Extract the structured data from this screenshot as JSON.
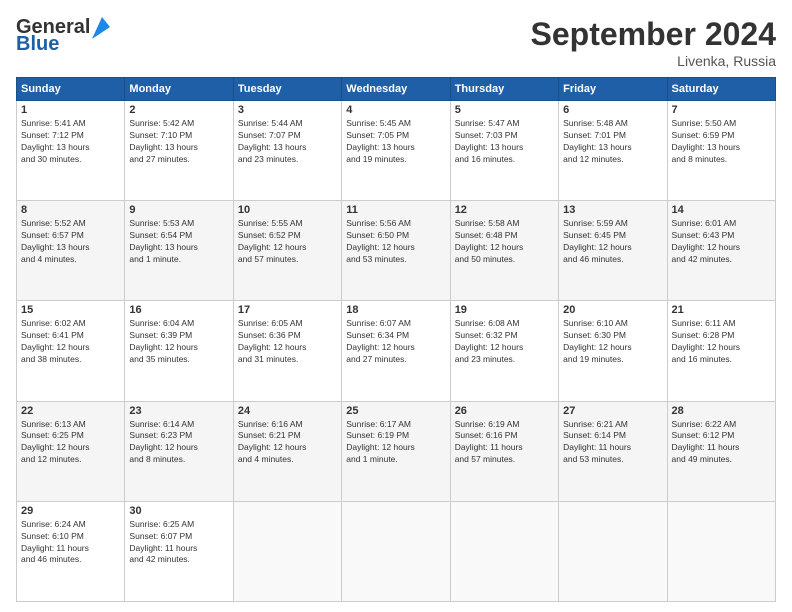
{
  "header": {
    "logo_general": "General",
    "logo_blue": "Blue",
    "month_title": "September 2024",
    "location": "Livenka, Russia"
  },
  "days_of_week": [
    "Sunday",
    "Monday",
    "Tuesday",
    "Wednesday",
    "Thursday",
    "Friday",
    "Saturday"
  ],
  "weeks": [
    [
      {
        "day": "1",
        "content": "Sunrise: 5:41 AM\nSunset: 7:12 PM\nDaylight: 13 hours\nand 30 minutes."
      },
      {
        "day": "2",
        "content": "Sunrise: 5:42 AM\nSunset: 7:10 PM\nDaylight: 13 hours\nand 27 minutes."
      },
      {
        "day": "3",
        "content": "Sunrise: 5:44 AM\nSunset: 7:07 PM\nDaylight: 13 hours\nand 23 minutes."
      },
      {
        "day": "4",
        "content": "Sunrise: 5:45 AM\nSunset: 7:05 PM\nDaylight: 13 hours\nand 19 minutes."
      },
      {
        "day": "5",
        "content": "Sunrise: 5:47 AM\nSunset: 7:03 PM\nDaylight: 13 hours\nand 16 minutes."
      },
      {
        "day": "6",
        "content": "Sunrise: 5:48 AM\nSunset: 7:01 PM\nDaylight: 13 hours\nand 12 minutes."
      },
      {
        "day": "7",
        "content": "Sunrise: 5:50 AM\nSunset: 6:59 PM\nDaylight: 13 hours\nand 8 minutes."
      }
    ],
    [
      {
        "day": "8",
        "content": "Sunrise: 5:52 AM\nSunset: 6:57 PM\nDaylight: 13 hours\nand 4 minutes."
      },
      {
        "day": "9",
        "content": "Sunrise: 5:53 AM\nSunset: 6:54 PM\nDaylight: 13 hours\nand 1 minute."
      },
      {
        "day": "10",
        "content": "Sunrise: 5:55 AM\nSunset: 6:52 PM\nDaylight: 12 hours\nand 57 minutes."
      },
      {
        "day": "11",
        "content": "Sunrise: 5:56 AM\nSunset: 6:50 PM\nDaylight: 12 hours\nand 53 minutes."
      },
      {
        "day": "12",
        "content": "Sunrise: 5:58 AM\nSunset: 6:48 PM\nDaylight: 12 hours\nand 50 minutes."
      },
      {
        "day": "13",
        "content": "Sunrise: 5:59 AM\nSunset: 6:45 PM\nDaylight: 12 hours\nand 46 minutes."
      },
      {
        "day": "14",
        "content": "Sunrise: 6:01 AM\nSunset: 6:43 PM\nDaylight: 12 hours\nand 42 minutes."
      }
    ],
    [
      {
        "day": "15",
        "content": "Sunrise: 6:02 AM\nSunset: 6:41 PM\nDaylight: 12 hours\nand 38 minutes."
      },
      {
        "day": "16",
        "content": "Sunrise: 6:04 AM\nSunset: 6:39 PM\nDaylight: 12 hours\nand 35 minutes."
      },
      {
        "day": "17",
        "content": "Sunrise: 6:05 AM\nSunset: 6:36 PM\nDaylight: 12 hours\nand 31 minutes."
      },
      {
        "day": "18",
        "content": "Sunrise: 6:07 AM\nSunset: 6:34 PM\nDaylight: 12 hours\nand 27 minutes."
      },
      {
        "day": "19",
        "content": "Sunrise: 6:08 AM\nSunset: 6:32 PM\nDaylight: 12 hours\nand 23 minutes."
      },
      {
        "day": "20",
        "content": "Sunrise: 6:10 AM\nSunset: 6:30 PM\nDaylight: 12 hours\nand 19 minutes."
      },
      {
        "day": "21",
        "content": "Sunrise: 6:11 AM\nSunset: 6:28 PM\nDaylight: 12 hours\nand 16 minutes."
      }
    ],
    [
      {
        "day": "22",
        "content": "Sunrise: 6:13 AM\nSunset: 6:25 PM\nDaylight: 12 hours\nand 12 minutes."
      },
      {
        "day": "23",
        "content": "Sunrise: 6:14 AM\nSunset: 6:23 PM\nDaylight: 12 hours\nand 8 minutes."
      },
      {
        "day": "24",
        "content": "Sunrise: 6:16 AM\nSunset: 6:21 PM\nDaylight: 12 hours\nand 4 minutes."
      },
      {
        "day": "25",
        "content": "Sunrise: 6:17 AM\nSunset: 6:19 PM\nDaylight: 12 hours\nand 1 minute."
      },
      {
        "day": "26",
        "content": "Sunrise: 6:19 AM\nSunset: 6:16 PM\nDaylight: 11 hours\nand 57 minutes."
      },
      {
        "day": "27",
        "content": "Sunrise: 6:21 AM\nSunset: 6:14 PM\nDaylight: 11 hours\nand 53 minutes."
      },
      {
        "day": "28",
        "content": "Sunrise: 6:22 AM\nSunset: 6:12 PM\nDaylight: 11 hours\nand 49 minutes."
      }
    ],
    [
      {
        "day": "29",
        "content": "Sunrise: 6:24 AM\nSunset: 6:10 PM\nDaylight: 11 hours\nand 46 minutes."
      },
      {
        "day": "30",
        "content": "Sunrise: 6:25 AM\nSunset: 6:07 PM\nDaylight: 11 hours\nand 42 minutes."
      },
      {
        "day": "",
        "content": ""
      },
      {
        "day": "",
        "content": ""
      },
      {
        "day": "",
        "content": ""
      },
      {
        "day": "",
        "content": ""
      },
      {
        "day": "",
        "content": ""
      }
    ]
  ]
}
